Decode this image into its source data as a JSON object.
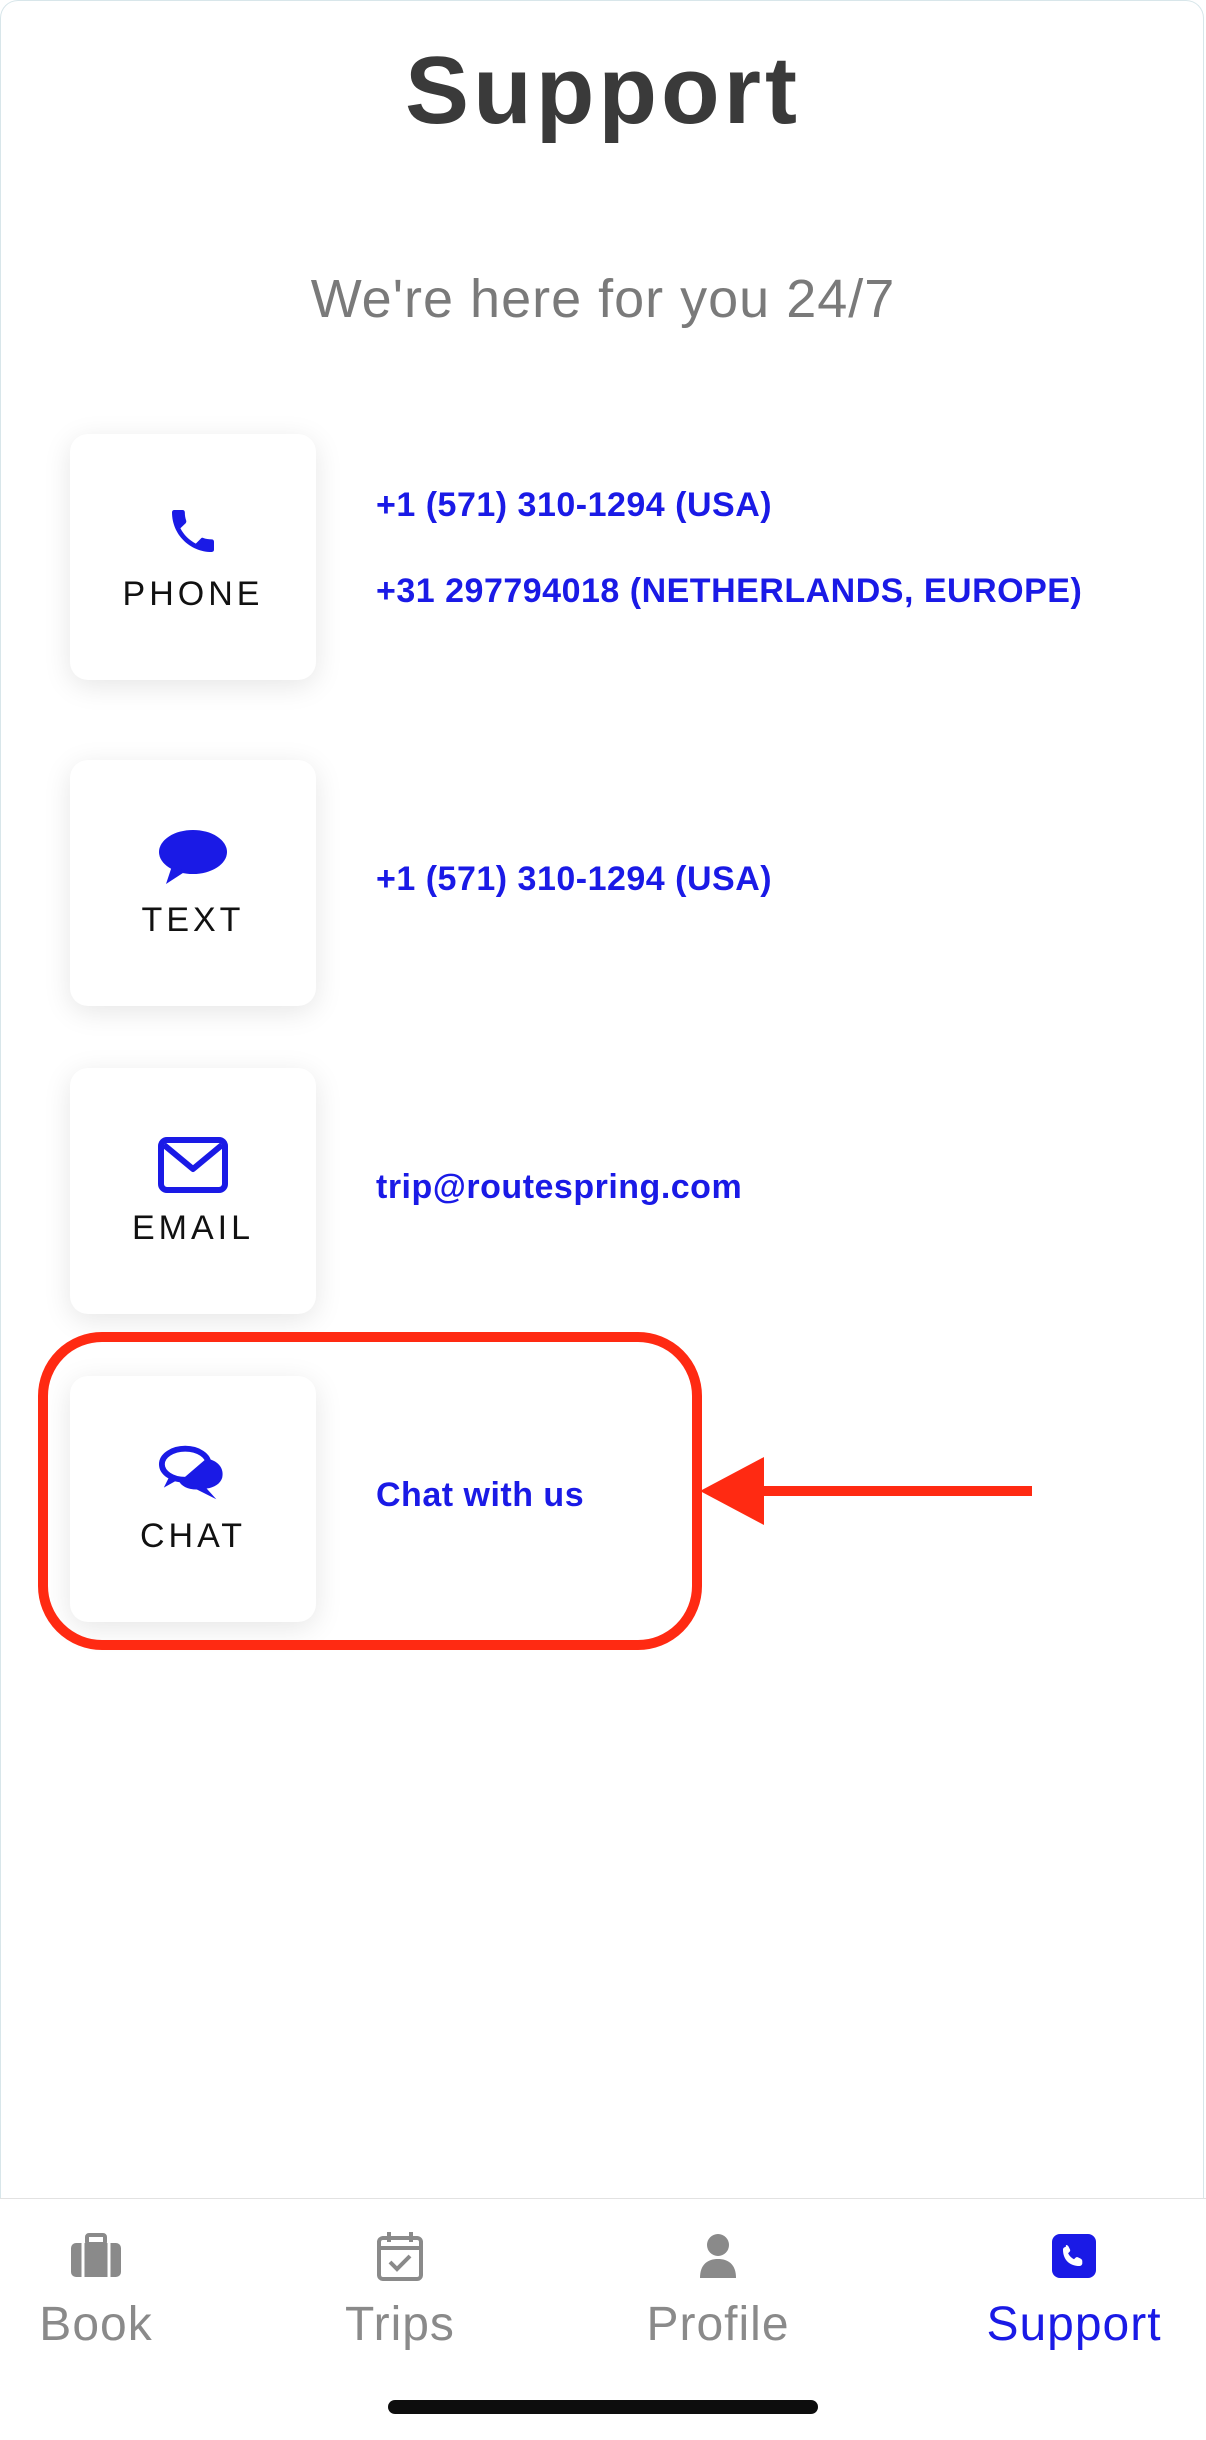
{
  "header": {
    "title": "Support",
    "subtitle": "We're here for you 24/7"
  },
  "contacts": {
    "phone": {
      "label": "PHONE",
      "icon": "phone-icon",
      "numbers": [
        "+1 (571) 310-1294 (USA)",
        "+31 297794018 (NETHERLANDS, EUROPE)"
      ]
    },
    "text": {
      "label": "TEXT",
      "icon": "speech-bubble-icon",
      "number": "+1 (571) 310-1294 (USA)"
    },
    "email": {
      "label": "EMAIL",
      "icon": "envelope-icon",
      "address": "trip@routespring.com"
    },
    "chat": {
      "label": "CHAT",
      "icon": "chat-bubbles-icon",
      "link": "Chat with us"
    }
  },
  "annotation": {
    "highlight_color": "#ff2a12",
    "target": "chat"
  },
  "tabbar": {
    "active": "Support",
    "tabs": [
      {
        "label": "Book",
        "icon": "briefcase-icon"
      },
      {
        "label": "Trips",
        "icon": "calendar-check-icon"
      },
      {
        "label": "Profile",
        "icon": "person-icon"
      },
      {
        "label": "Support",
        "icon": "phone-square-icon"
      }
    ]
  },
  "colors": {
    "accent": "#1a1ae6",
    "inactive": "#8a8a8a",
    "title": "#3a3a3a"
  }
}
